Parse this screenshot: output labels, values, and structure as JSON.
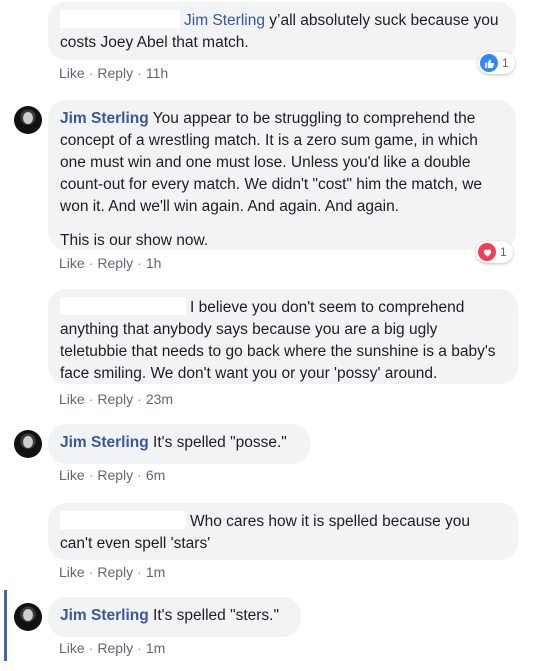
{
  "colors": {
    "author": "#385898",
    "bubble": "#f2f3f5",
    "meta": "#606770",
    "like": "#2d88ff",
    "love": "#f33e58",
    "highlight": "#4267b2"
  },
  "comments": [
    {
      "author": "Jim Sterling",
      "text": " y’all absolutely suck because you costs Joey Abel that match.",
      "actions": {
        "like": "Like",
        "reply": "Reply",
        "time": "11h"
      },
      "reaction": {
        "type": "like",
        "icon": "thumbs-up-icon",
        "count": "1"
      }
    },
    {
      "author": "Jim Sterling",
      "text": " You appear to be struggling to comprehend the concept of a wrestling match. It is a zero sum game, in which one must win and one must lose. Unless you'd like a double count-out for every match. We didn't \"cost\" him the match, we won it. And we'll win again. And again. And again.",
      "text2": "This is our show now.",
      "actions": {
        "like": "Like",
        "reply": "Reply",
        "time": "1h"
      },
      "reaction": {
        "type": "love",
        "icon": "heart-icon",
        "count": "1"
      }
    },
    {
      "text": "I believe you don't seem to comprehend anything that anybody says because you are a big ugly teletubbie that needs to go back where the sunshine is a baby's face smiling. We don't want you or your 'possy' around.",
      "actions": {
        "like": "Like",
        "reply": "Reply",
        "time": "23m"
      }
    },
    {
      "author": "Jim Sterling",
      "text": " It's spelled \"posse.\"",
      "actions": {
        "like": "Like",
        "reply": "Reply",
        "time": "6m"
      }
    },
    {
      "text": "Who cares how it is spelled because you can't even spell 'stars'",
      "actions": {
        "like": "Like",
        "reply": "Reply",
        "time": "1m"
      }
    },
    {
      "author": "Jim Sterling",
      "text": " It's spelled \"sters.\"",
      "actions": {
        "like": "Like",
        "reply": "Reply",
        "time": "1m"
      }
    }
  ],
  "separator": "·"
}
